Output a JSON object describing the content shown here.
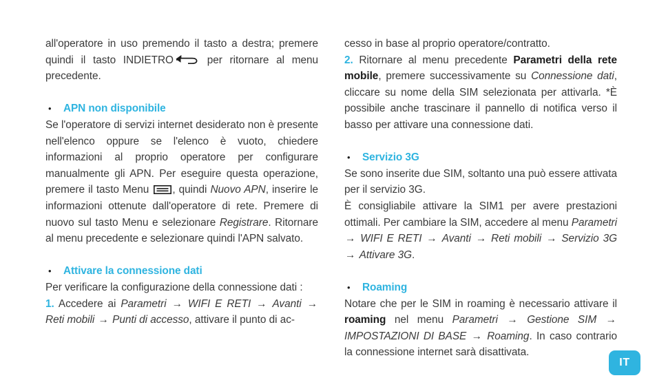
{
  "page": {
    "language_badge": "IT",
    "accent_color": "#2fb4e0",
    "text_color": "#3a3a3a",
    "background_color": "#ffffff"
  },
  "left_column": {
    "continued_paragraph": {
      "part1": "all'operatore in uso premendo il tasto a destra; premere quindi il tasto INDIETRO",
      "icon": "back-arrow-icon",
      "part2": "per ritornare al menu precedente."
    },
    "section_apn": {
      "bullet": "•",
      "heading": "APN non disponibile",
      "body_part1": "Se l'operatore di servizi internet desiderato non è presente nell'elenco oppure se l'elenco è vuoto, chiedere informazioni al proprio operatore per configurare manualmente gli APN. Per eseguire questa operazione, premere il tasto Menu",
      "icon": "menu-icon",
      "body_part2": ", quindi ",
      "italic_nuovo_apn": "Nuovo APN",
      "body_part3": ", inserire le informazioni ottenute dall'operatore di rete. Premere di nuovo sul tasto Menu e selezionare ",
      "italic_registrare": "Registrare",
      "body_part4": ". Ritornare al menu precedente e selezionare quindi l'APN salvato."
    },
    "section_attivare": {
      "bullet": "•",
      "heading": "Attivare la connessione dati",
      "intro": "Per verificare la configurazione della connessione dati :",
      "step_number": "1.",
      "step_text_before": " Accedere ai ",
      "path": [
        "Parametri",
        "WIFI E RETI",
        "Avanti",
        "Reti mobili",
        "Punti di accesso"
      ],
      "path_separator": "→",
      "step_text_after": ", attivare il punto di ac-"
    }
  },
  "right_column": {
    "continued_text": "cesso in base al proprio operatore/contratto.",
    "step2": {
      "step_number": "2.",
      "text_before": " Ritornare al menu precedente ",
      "bold_label": "Parametri della rete mobile",
      "text_middle": ", premere successivamente su ",
      "italic_connessione_dati": "Connessione dati",
      "text_after": ", cliccare su nome della SIM selezionata per attivarla. *È possibile anche trascinare il pannello di notifica verso il basso per attivare una connessione dati."
    },
    "section_3g": {
      "bullet": "•",
      "heading": "Servizio 3G",
      "body_part1": "Se sono inserite due SIM, soltanto una può essere attivata per il servizio 3G.",
      "body_part2": "È consigliabile attivare la SIM1 per avere prestazioni ottimali. Per cambiare la SIM, accedere al menu ",
      "path": [
        "Parametri",
        "WIFI E RETI",
        "Avanti",
        "Reti mobili",
        "Servizio 3G",
        "Attivare 3G"
      ],
      "path_separator": "→",
      "body_end": "."
    },
    "section_roaming": {
      "bullet": "•",
      "heading": "Roaming",
      "body_part1": "Notare che per le SIM in roaming è necessario attivare il ",
      "bold_roaming": "roaming",
      "body_part2": " nel menu ",
      "path": [
        "Parametri",
        "Gestione SIM",
        "IMPOSTAZIONI DI BASE",
        "Roaming"
      ],
      "path_separator": "→",
      "body_part3": ". In caso contrario la connessione internet sarà disattivata."
    }
  }
}
